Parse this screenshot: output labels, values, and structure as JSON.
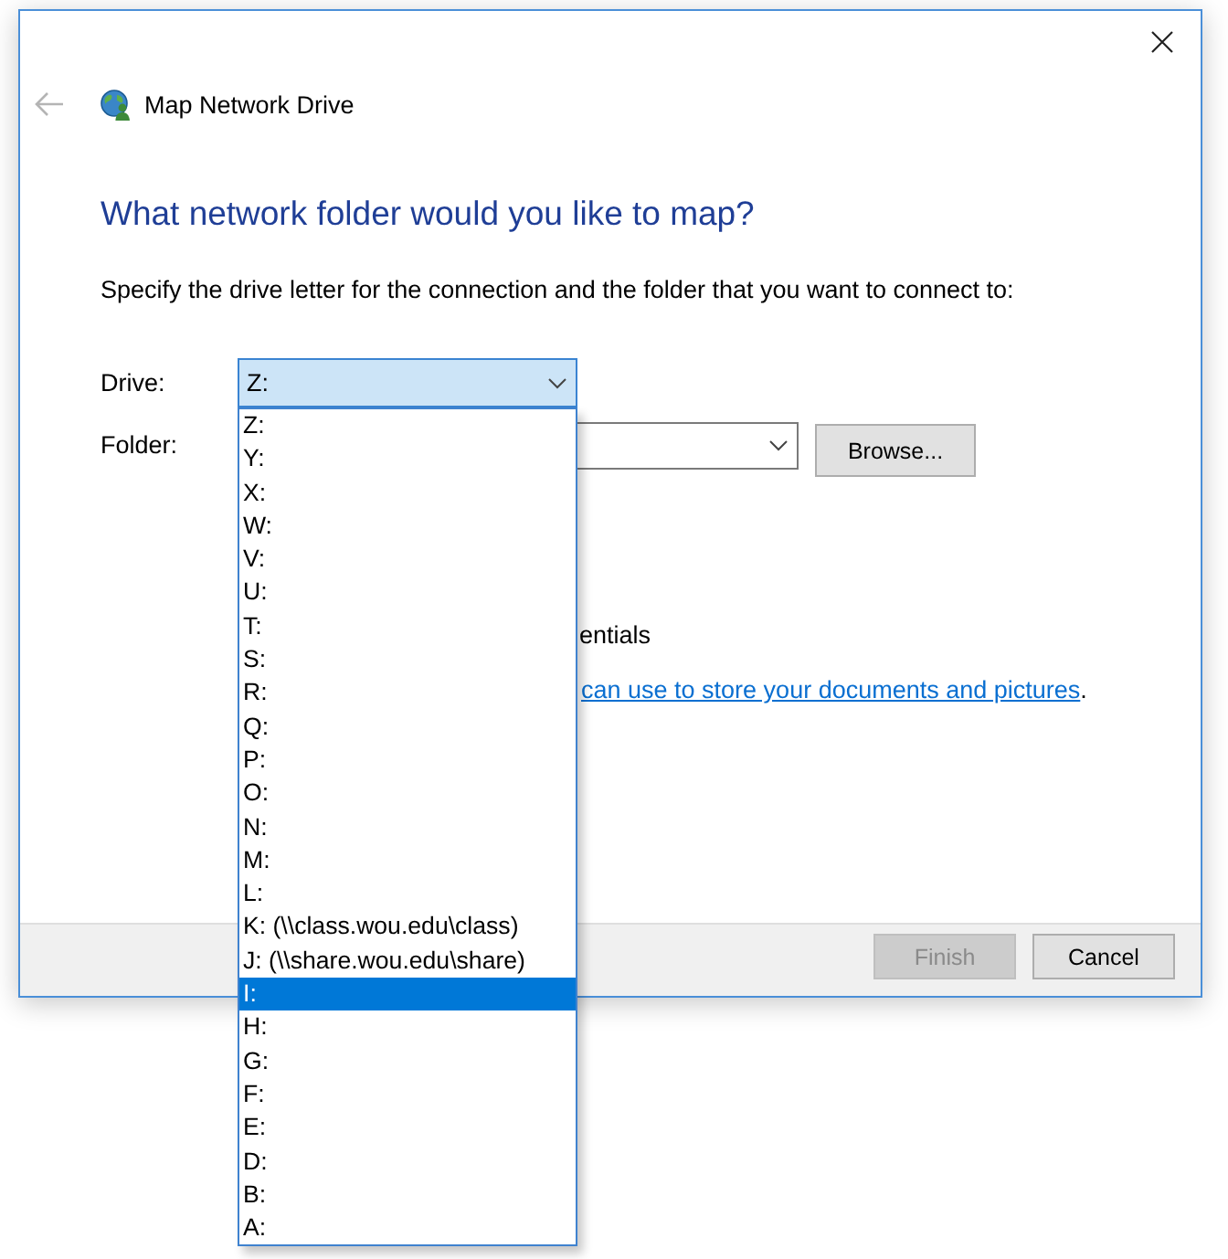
{
  "window": {
    "title": "Map Network Drive",
    "back_button": {
      "disabled": true
    }
  },
  "heading": "What network folder would you like to map?",
  "instruction": "Specify the drive letter for the connection and the folder that you want to connect to:",
  "drive": {
    "label": "Drive:",
    "value": "Z:",
    "open": true
  },
  "folder": {
    "label": "Folder:"
  },
  "browse_button": "Browse...",
  "option_fragment": "entials",
  "web_site_line": {
    "link": "can use to store your documents and pictures",
    "tail": "."
  },
  "drive_list": [
    {
      "label": "Z:",
      "selected": false
    },
    {
      "label": "Y:",
      "selected": false
    },
    {
      "label": "X:",
      "selected": false
    },
    {
      "label": "W:",
      "selected": false
    },
    {
      "label": "V:",
      "selected": false
    },
    {
      "label": "U:",
      "selected": false
    },
    {
      "label": "T:",
      "selected": false
    },
    {
      "label": "S:",
      "selected": false
    },
    {
      "label": "R:",
      "selected": false
    },
    {
      "label": "Q:",
      "selected": false
    },
    {
      "label": "P:",
      "selected": false
    },
    {
      "label": "O:",
      "selected": false
    },
    {
      "label": "N:",
      "selected": false
    },
    {
      "label": "M:",
      "selected": false
    },
    {
      "label": "L:",
      "selected": false
    },
    {
      "label": "K: (\\\\class.wou.edu\\class)",
      "selected": false
    },
    {
      "label": "J: (\\\\share.wou.edu\\share)",
      "selected": false
    },
    {
      "label": "I:",
      "selected": true
    },
    {
      "label": "H:",
      "selected": false
    },
    {
      "label": "G:",
      "selected": false
    },
    {
      "label": "F:",
      "selected": false
    },
    {
      "label": "E:",
      "selected": false
    },
    {
      "label": "D:",
      "selected": false
    },
    {
      "label": "B:",
      "selected": false
    },
    {
      "label": "A:",
      "selected": false
    }
  ],
  "buttons": [
    {
      "label": "Finish",
      "disabled": true
    },
    {
      "label": "Cancel",
      "disabled": false
    }
  ]
}
